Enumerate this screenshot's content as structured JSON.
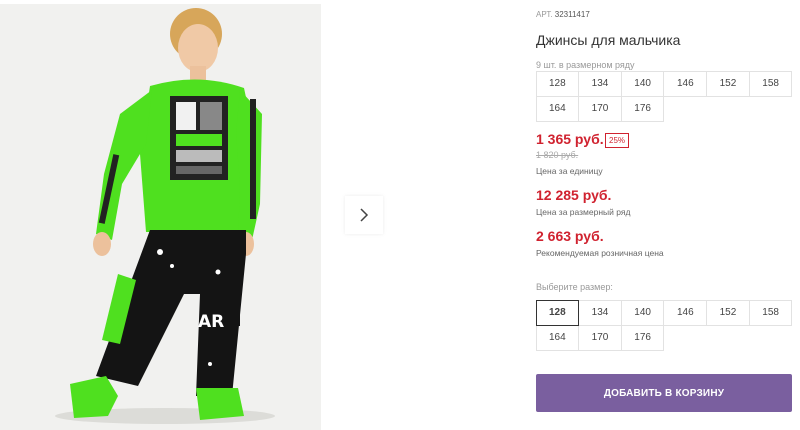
{
  "product": {
    "art_label": "АРТ.",
    "art_number": "32311417",
    "title": "Джинсы для мальчика"
  },
  "size_range": {
    "count_text": "9 шт. в размерном ряду",
    "sizes": [
      "128",
      "134",
      "140",
      "146",
      "152",
      "158",
      "164",
      "170",
      "176"
    ]
  },
  "prices": {
    "unit_price": "1 365 руб.",
    "discount": "25%",
    "old_price": "1 820 руб.",
    "unit_note": "Цена за единицу",
    "range_price": "12 285 руб.",
    "range_note": "Цена за размерный ряд",
    "retail_price": "2 663 руб.",
    "retail_note": "Рекомендуемая розничная цена"
  },
  "size_select": {
    "label": "Выберите размер:",
    "sizes": [
      "128",
      "134",
      "140",
      "146",
      "152",
      "158",
      "164",
      "170",
      "176"
    ],
    "selected": "128"
  },
  "cart": {
    "button_label": "ДОБАВИТЬ В КОРЗИНУ"
  },
  "gallery": {
    "next_icon": "chevron-right-icon"
  },
  "colors": {
    "accent_red": "#d0222f",
    "button_purple": "#7a5f9f",
    "shirt_green": "#4fe01f"
  }
}
